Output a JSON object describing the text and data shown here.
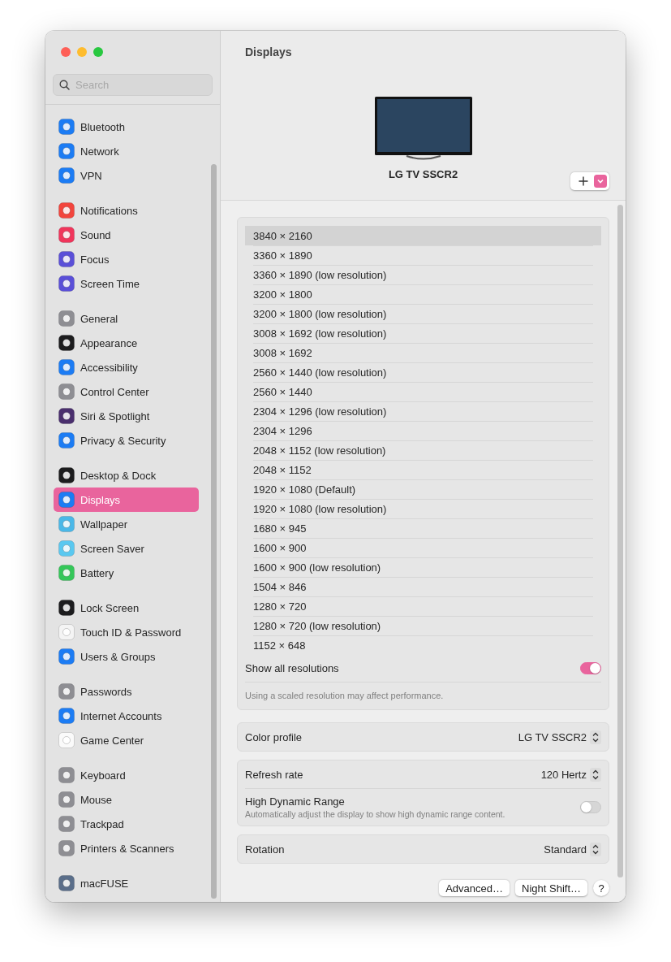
{
  "search": {
    "placeholder": "Search"
  },
  "sidebar": {
    "groups": [
      {
        "items": [
          {
            "label": "Bluetooth",
            "color": "#1c7cf4",
            "selected": false
          },
          {
            "label": "Network",
            "color": "#1c7cf4",
            "selected": false
          },
          {
            "label": "VPN",
            "color": "#1c7cf4",
            "selected": false
          }
        ]
      },
      {
        "items": [
          {
            "label": "Notifications",
            "color": "#f2453d",
            "selected": false
          },
          {
            "label": "Sound",
            "color": "#f0355b",
            "selected": false
          },
          {
            "label": "Focus",
            "color": "#5a4fd8",
            "selected": false
          },
          {
            "label": "Screen Time",
            "color": "#5a4fd8",
            "selected": false
          }
        ]
      },
      {
        "items": [
          {
            "label": "General",
            "color": "#8e8e93",
            "selected": false
          },
          {
            "label": "Appearance",
            "color": "#1c1c1e",
            "selected": false
          },
          {
            "label": "Accessibility",
            "color": "#1c7cf4",
            "selected": false
          },
          {
            "label": "Control Center",
            "color": "#8e8e93",
            "selected": false
          },
          {
            "label": "Siri & Spotlight",
            "color": "#4a2f6e",
            "selected": false
          },
          {
            "label": "Privacy & Security",
            "color": "#1c7cf4",
            "selected": false
          }
        ]
      },
      {
        "items": [
          {
            "label": "Desktop & Dock",
            "color": "#1c1c1e",
            "selected": false
          },
          {
            "label": "Displays",
            "color": "#1c7cf4",
            "selected": true
          },
          {
            "label": "Wallpaper",
            "color": "#4ab8e8",
            "selected": false
          },
          {
            "label": "Screen Saver",
            "color": "#5ac8f0",
            "selected": false
          },
          {
            "label": "Battery",
            "color": "#34c759",
            "selected": false
          }
        ]
      },
      {
        "items": [
          {
            "label": "Lock Screen",
            "color": "#1c1c1e",
            "selected": false
          },
          {
            "label": "Touch ID & Password",
            "color": "#f4f4f4",
            "selected": false
          },
          {
            "label": "Users & Groups",
            "color": "#1c7cf4",
            "selected": false
          }
        ]
      },
      {
        "items": [
          {
            "label": "Passwords",
            "color": "#8e8e93",
            "selected": false
          },
          {
            "label": "Internet Accounts",
            "color": "#1c7cf4",
            "selected": false
          },
          {
            "label": "Game Center",
            "color": "#fafafa",
            "selected": false
          }
        ]
      },
      {
        "items": [
          {
            "label": "Keyboard",
            "color": "#8e8e93",
            "selected": false
          },
          {
            "label": "Mouse",
            "color": "#8e8e93",
            "selected": false
          },
          {
            "label": "Trackpad",
            "color": "#8e8e93",
            "selected": false
          },
          {
            "label": "Printers & Scanners",
            "color": "#8e8e93",
            "selected": false
          }
        ]
      },
      {
        "items": [
          {
            "label": "macFUSE",
            "color": "#5a6e8a",
            "selected": false
          }
        ]
      }
    ]
  },
  "header": {
    "title": "Displays",
    "display_name": "LG TV SSCR2"
  },
  "resolutions": [
    {
      "label": "3840 × 2160",
      "selected": true
    },
    {
      "label": "3360 × 1890",
      "selected": false
    },
    {
      "label": "3360 × 1890 (low resolution)",
      "selected": false
    },
    {
      "label": "3200 × 1800",
      "selected": false
    },
    {
      "label": "3200 × 1800 (low resolution)",
      "selected": false
    },
    {
      "label": "3008 × 1692 (low resolution)",
      "selected": false
    },
    {
      "label": "3008 × 1692",
      "selected": false
    },
    {
      "label": "2560 × 1440 (low resolution)",
      "selected": false
    },
    {
      "label": "2560 × 1440",
      "selected": false
    },
    {
      "label": "2304 × 1296 (low resolution)",
      "selected": false
    },
    {
      "label": "2304 × 1296",
      "selected": false
    },
    {
      "label": "2048 × 1152 (low resolution)",
      "selected": false
    },
    {
      "label": "2048 × 1152",
      "selected": false
    },
    {
      "label": "1920 × 1080 (Default)",
      "selected": false
    },
    {
      "label": "1920 × 1080 (low resolution)",
      "selected": false
    },
    {
      "label": "1680 × 945",
      "selected": false
    },
    {
      "label": "1600 × 900",
      "selected": false
    },
    {
      "label": "1600 × 900 (low resolution)",
      "selected": false
    },
    {
      "label": "1504 × 846",
      "selected": false
    },
    {
      "label": "1280 × 720",
      "selected": false
    },
    {
      "label": "1280 × 720 (low resolution)",
      "selected": false
    },
    {
      "label": "1152 × 648",
      "selected": false
    }
  ],
  "show_all": {
    "label": "Show all resolutions",
    "on": true
  },
  "note": "Using a scaled resolution may affect performance.",
  "settings": [
    {
      "rows": [
        {
          "kind": "popup",
          "label": "Color profile",
          "value": "LG TV SSCR2"
        }
      ]
    },
    {
      "rows": [
        {
          "kind": "popup",
          "label": "Refresh rate",
          "value": "120 Hertz"
        },
        {
          "kind": "toggle",
          "label": "High Dynamic Range",
          "description": "Automatically adjust the display to show high dynamic range content.",
          "on": false
        }
      ]
    },
    {
      "rows": [
        {
          "kind": "popup",
          "label": "Rotation",
          "value": "Standard"
        }
      ]
    }
  ],
  "buttons": [
    {
      "label": "Advanced…",
      "kind": "text"
    },
    {
      "label": "Night Shift…",
      "kind": "text"
    },
    {
      "label": "?",
      "kind": "help"
    }
  ]
}
